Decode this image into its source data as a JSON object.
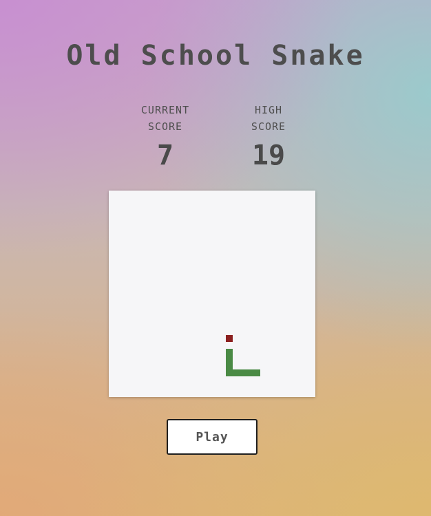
{
  "title": "Old School Snake",
  "scores": {
    "current_label": "CURRENT\nSCORE",
    "current_value": "7",
    "high_label": "HIGH\nSCORE",
    "high_value": "19"
  },
  "board": {
    "grid_size": 30,
    "background_color": "#f6f6f8",
    "snake_color": "#4a8a45",
    "food_color": "#8b1f1f",
    "food": [
      17,
      21
    ],
    "snake": [
      [
        17,
        23
      ],
      [
        17,
        24
      ],
      [
        17,
        25
      ],
      [
        17,
        26
      ],
      [
        18,
        26
      ],
      [
        19,
        26
      ],
      [
        20,
        26
      ],
      [
        21,
        26
      ]
    ]
  },
  "play_button": {
    "label": "Play"
  }
}
